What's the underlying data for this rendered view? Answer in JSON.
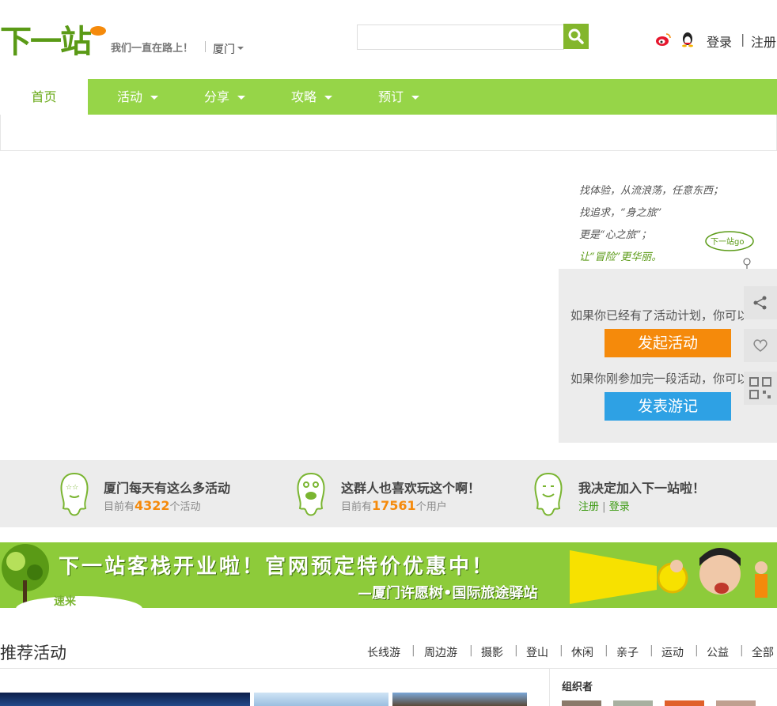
{
  "header": {
    "logo_text": "下一站",
    "slogan": "我们一直在路上！",
    "city": "厦门",
    "search_placeholder": "",
    "login": "登录",
    "auth_separator": "|",
    "register": "注册"
  },
  "nav": {
    "items": [
      {
        "label": "首页",
        "active": true
      },
      {
        "label": "活动",
        "dropdown": true
      },
      {
        "label": "分享",
        "dropdown": true
      },
      {
        "label": "攻略",
        "dropdown": true
      },
      {
        "label": "预订",
        "dropdown": true
      }
    ]
  },
  "hero": {
    "hand_note_lines": [
      "找体验，从流浪荡，任意东西；",
      "找追求，“身之旅”",
      "更是“心之旅”；",
      "让“冒险”更华丽。"
    ],
    "hand_note_sign": "下一站go",
    "panel_text1": "如果你已经有了活动计划，你可以",
    "start_button": "发起活动",
    "panel_text2": "如果你刚参加完一段活动，你可以",
    "travel_button": "发表游记"
  },
  "side_tools": [
    "share-icon",
    "heart-icon",
    "qr-code-icon"
  ],
  "stats": [
    {
      "title": "厦门每天有这么多活动",
      "prefix": "目前有",
      "number": "4322",
      "suffix": "个活动"
    },
    {
      "title": "这群人也喜欢玩这个啊！",
      "prefix": "目前有",
      "number": "17561",
      "suffix": "个用户"
    },
    {
      "title": "我决定加入下一站啦！",
      "register": "注册",
      "sep": "|",
      "login": "登录"
    }
  ],
  "banner": {
    "title": "下一站客栈开业啦！官网预定特价优惠中！",
    "subtitle": "—厦门许愿树•国际旅途驿站",
    "speed": "速来"
  },
  "recommend": {
    "title": "推荐活动",
    "categories": [
      "长线游",
      "周边游",
      "摄影",
      "登山",
      "休闲",
      "亲子",
      "运动",
      "公益",
      "全部"
    ],
    "organizer_title": "组织者"
  },
  "colors": {
    "nav_green": "#96d548",
    "orange": "#f58a0b",
    "blue": "#2ea1e4"
  }
}
